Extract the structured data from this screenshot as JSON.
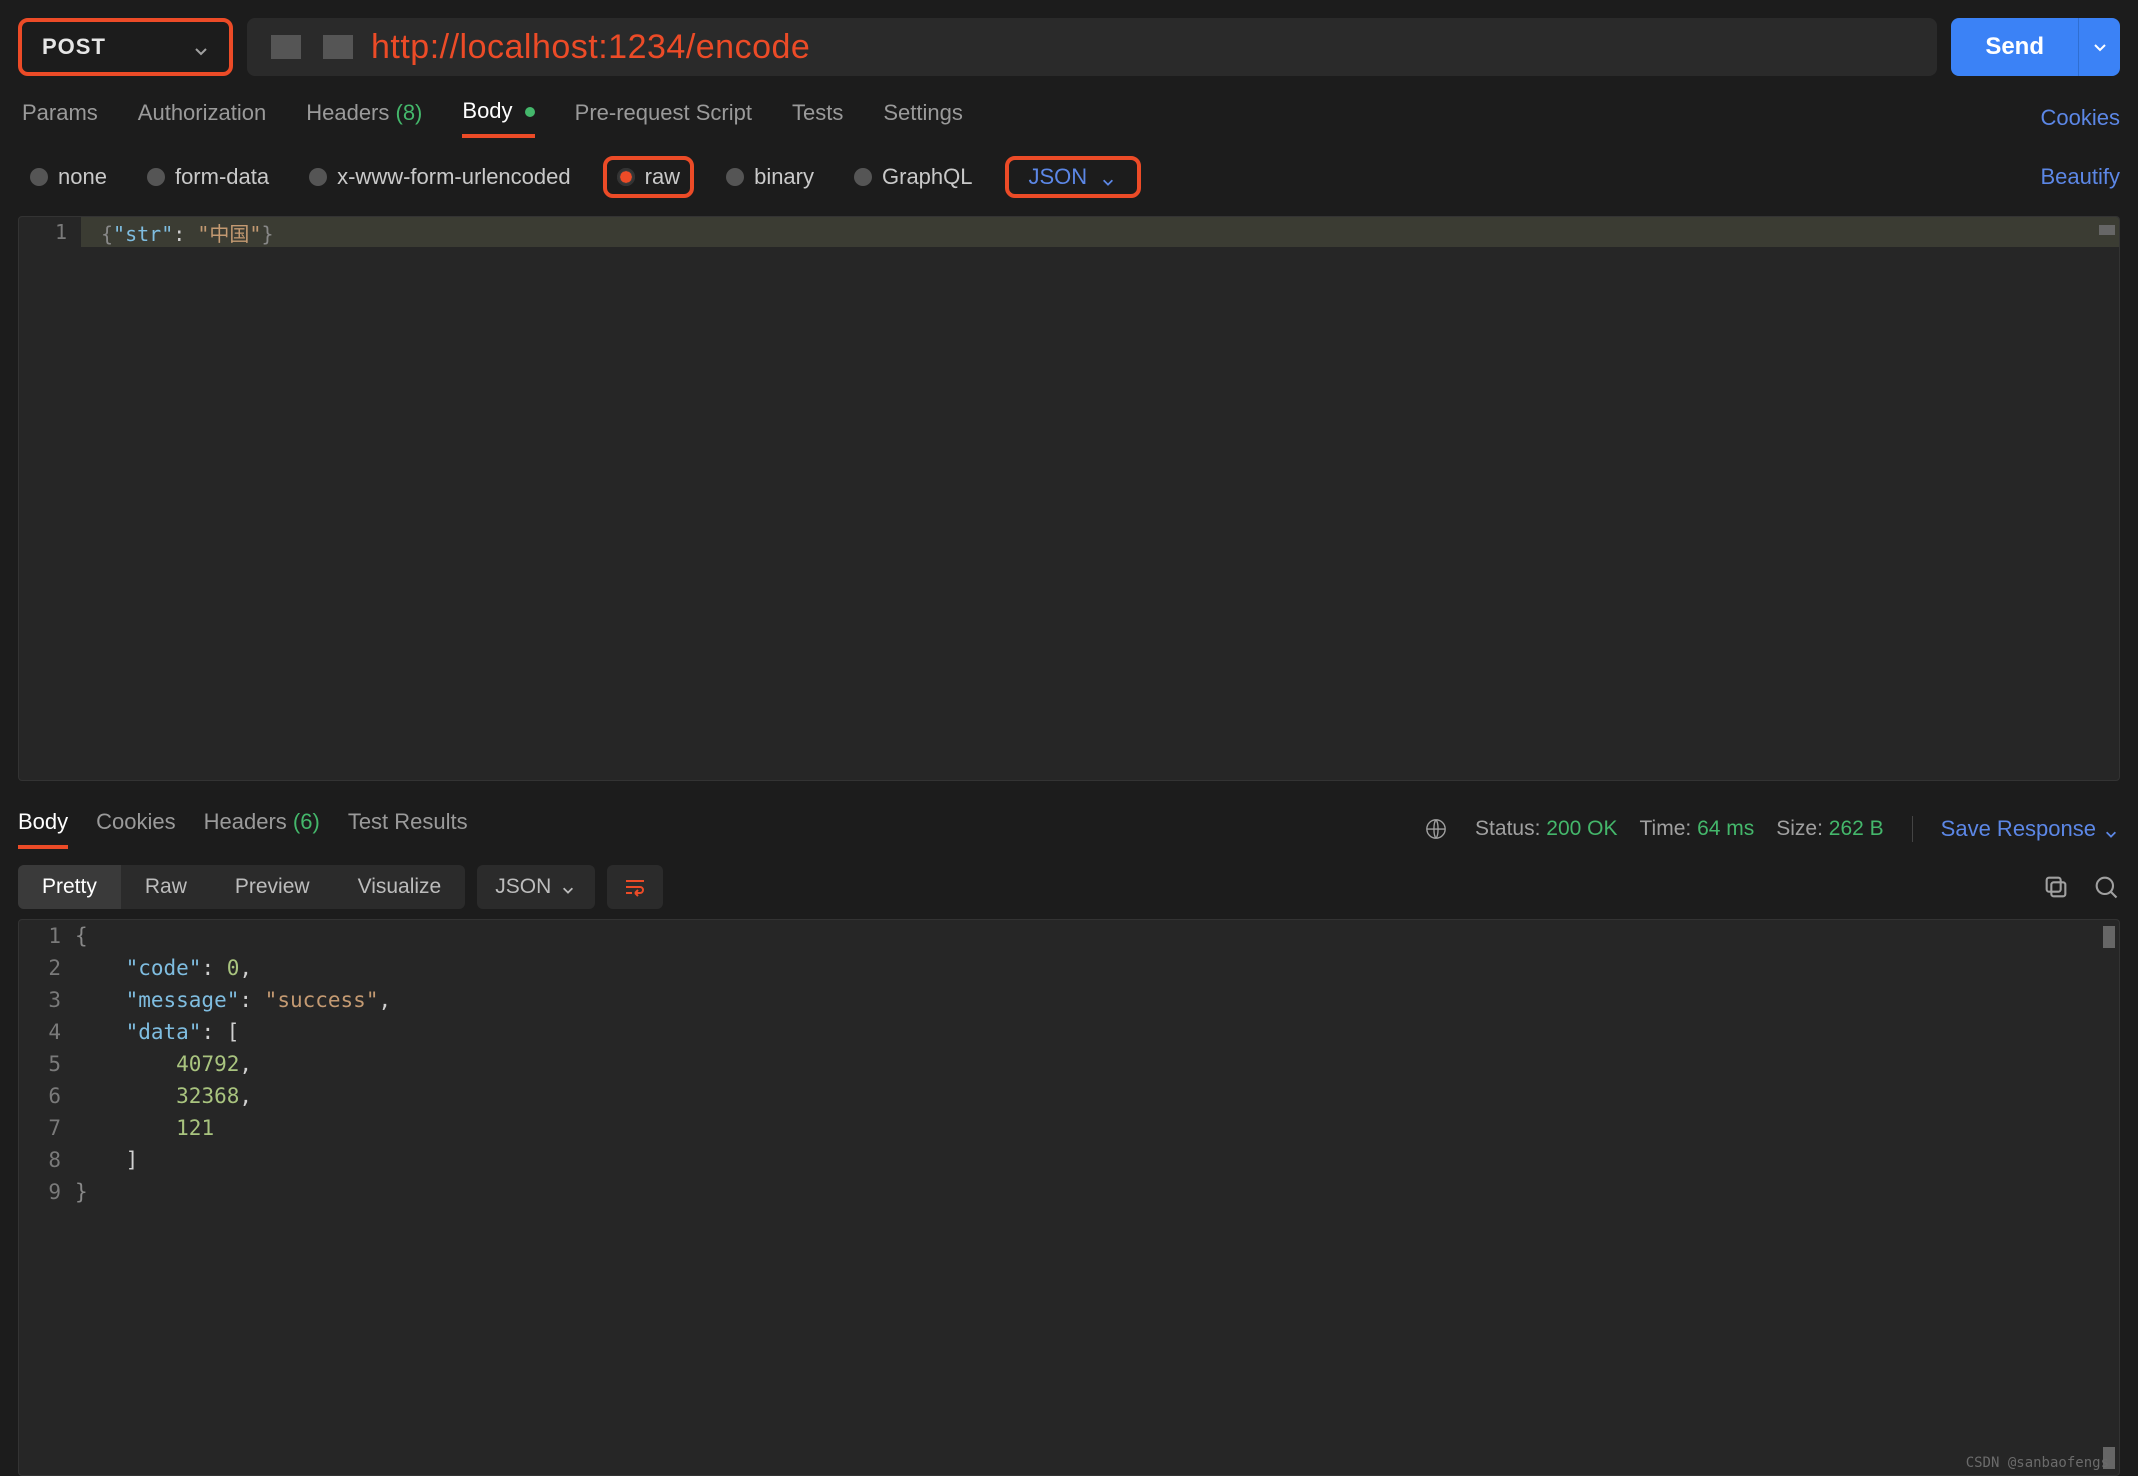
{
  "request": {
    "method": "POST",
    "url": "http://localhost:1234/encode",
    "send_label": "Send"
  },
  "tabs": {
    "params": "Params",
    "authorization": "Authorization",
    "headers_label": "Headers",
    "headers_count": "(8)",
    "body": "Body",
    "prerequest": "Pre-request Script",
    "tests": "Tests",
    "settings": "Settings",
    "cookies_link": "Cookies"
  },
  "body_types": {
    "none": "none",
    "form_data": "form-data",
    "urlencoded": "x-www-form-urlencoded",
    "raw": "raw",
    "binary": "binary",
    "graphql": "GraphQL",
    "json_label": "JSON",
    "beautify": "Beautify"
  },
  "request_body": {
    "line_number": "1",
    "open": "{",
    "key": "\"str\"",
    "colon": ": ",
    "value": "\"中国\"",
    "close": "}"
  },
  "response_tabs": {
    "body": "Body",
    "cookies": "Cookies",
    "headers_label": "Headers",
    "headers_count": "(6)",
    "test_results": "Test Results"
  },
  "response_meta": {
    "status_label": "Status:",
    "status_value": "200 OK",
    "time_label": "Time:",
    "time_value": "64 ms",
    "size_label": "Size:",
    "size_value": "262 B",
    "save_response": "Save Response"
  },
  "response_toolbar": {
    "pretty": "Pretty",
    "raw": "Raw",
    "preview": "Preview",
    "visualize": "Visualize",
    "format": "JSON"
  },
  "response_body": {
    "lines": [
      "1",
      "2",
      "3",
      "4",
      "5",
      "6",
      "7",
      "8",
      "9"
    ],
    "l1": "{",
    "l2_key": "\"code\"",
    "l2_val": "0",
    "l3_key": "\"message\"",
    "l3_val": "\"success\"",
    "l4_key": "\"data\"",
    "l4_open": "[",
    "l5": "40792",
    "l6": "32368",
    "l7": "121",
    "l8": "]",
    "l9": "}"
  },
  "watermark": "CSDN @sanbaofengs"
}
